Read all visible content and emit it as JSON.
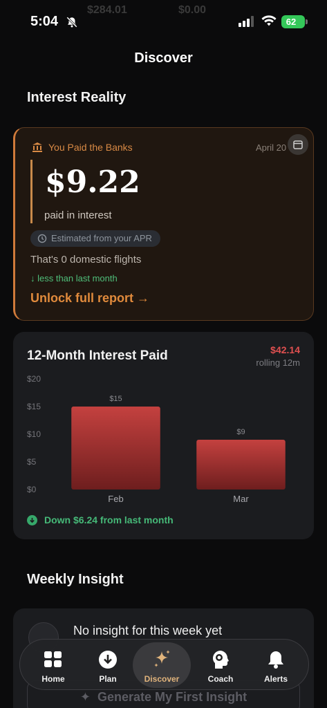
{
  "status": {
    "time": "5:04",
    "battery": "62",
    "ghost_left": "$284.01",
    "ghost_right": "$0.00"
  },
  "page": {
    "title": "Discover"
  },
  "interest_reality": {
    "section_title": "Interest Reality",
    "heading": "You Paid the Banks",
    "date": "April 20",
    "amount": "$9.22",
    "paid_label": "paid in interest",
    "estimate_chip": "Estimated from your APR",
    "flights": "That's 0 domestic flights",
    "trend": "↓ less than last month",
    "unlock": "Unlock full report →",
    "accent": "#e08a3c"
  },
  "chart_card": {
    "title": "12-Month Interest Paid",
    "total": "$42.14",
    "total_sub": "rolling 12m",
    "change": "Down $6.24 from last month",
    "bar_color_top": "#c4413f",
    "bar_color_bottom": "#6e1e1e"
  },
  "chart_data": {
    "type": "bar",
    "categories": [
      "Feb",
      "Mar"
    ],
    "values": [
      15,
      9
    ],
    "data_labels": [
      "$15",
      "$9"
    ],
    "ytick_labels": [
      "$0",
      "$5",
      "$10",
      "$15",
      "$20"
    ],
    "ylim": [
      0,
      20
    ],
    "grid": false
  },
  "weekly_insight": {
    "section_title": "Weekly Insight",
    "empty_title": "No insight for this week yet",
    "generate_button": "Generate My First Insight"
  },
  "tabs": [
    {
      "label": "Home",
      "icon": "grid-icon"
    },
    {
      "label": "Plan",
      "icon": "download-circle-icon"
    },
    {
      "label": "Discover",
      "icon": "sparkle-icon",
      "active": true
    },
    {
      "label": "Coach",
      "icon": "brain-head-icon"
    },
    {
      "label": "Alerts",
      "icon": "bell-icon"
    }
  ]
}
